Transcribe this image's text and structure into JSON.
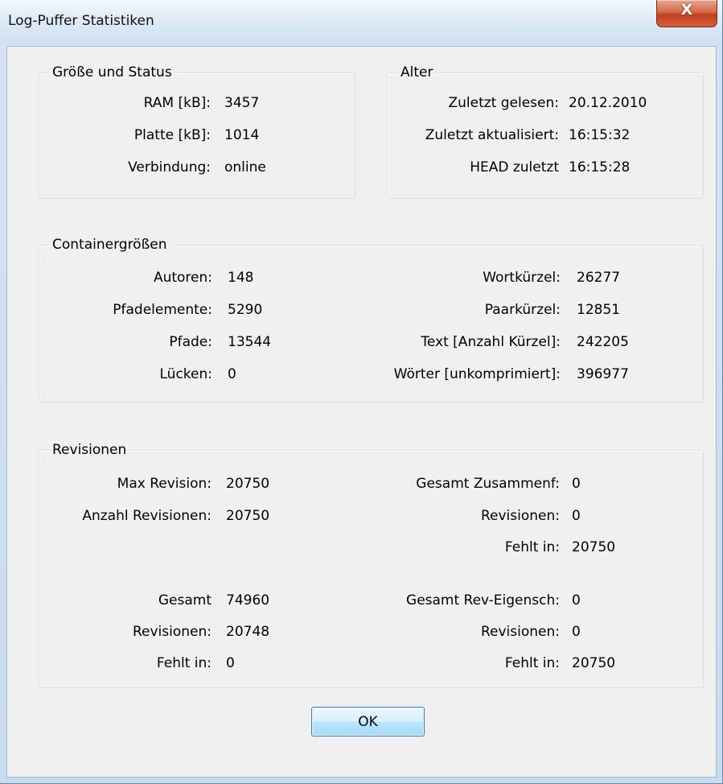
{
  "window": {
    "title": "Log-Puffer Statistiken",
    "close_glyph": "X"
  },
  "groups": {
    "size_status": {
      "title": "Größe und Status",
      "rows": [
        {
          "label": "RAM [kB]:",
          "value": "3457"
        },
        {
          "label": "Platte [kB]:",
          "value": "1014"
        },
        {
          "label": "Verbindung:",
          "value": "online"
        }
      ]
    },
    "age": {
      "title": "Alter",
      "rows": [
        {
          "label": "Zuletzt gelesen:",
          "value": "20.12.2010"
        },
        {
          "label": "Zuletzt aktualisiert:",
          "value": "16:15:32"
        },
        {
          "label": "HEAD zuletzt",
          "value": "16:15:28"
        }
      ]
    },
    "container_sizes": {
      "title": "Containergrößen",
      "left": [
        {
          "label": "Autoren:",
          "value": "148"
        },
        {
          "label": "Pfadelemente:",
          "value": "5290"
        },
        {
          "label": "Pfade:",
          "value": "13544"
        },
        {
          "label": "Lücken:",
          "value": "0"
        }
      ],
      "right": [
        {
          "label": "Wortkürzel:",
          "value": "26277"
        },
        {
          "label": "Paarkürzel:",
          "value": "12851"
        },
        {
          "label": "Text [Anzahl Kürzel]:",
          "value": "242205"
        },
        {
          "label": "Wörter [unkomprimiert]:",
          "value": "396977"
        }
      ]
    },
    "revisions": {
      "title": "Revisionen",
      "left_top": [
        {
          "label": "Max Revision:",
          "value": "20750"
        },
        {
          "label": "Anzahl Revisionen:",
          "value": "20750"
        }
      ],
      "right_top": [
        {
          "label": "Gesamt Zusammenf:",
          "value": "0"
        },
        {
          "label": "Revisionen:",
          "value": "0"
        },
        {
          "label": "Fehlt in:",
          "value": "20750"
        }
      ],
      "left_bottom": [
        {
          "label": "Gesamt",
          "value": "74960"
        },
        {
          "label": "Revisionen:",
          "value": "20748"
        },
        {
          "label": "Fehlt in:",
          "value": "0"
        }
      ],
      "right_bottom": [
        {
          "label": "Gesamt Rev-Eigensch:",
          "value": "0"
        },
        {
          "label": "Revisionen:",
          "value": "0"
        },
        {
          "label": "Fehlt in:",
          "value": "20750"
        }
      ]
    }
  },
  "buttons": {
    "ok_label": "OK"
  }
}
